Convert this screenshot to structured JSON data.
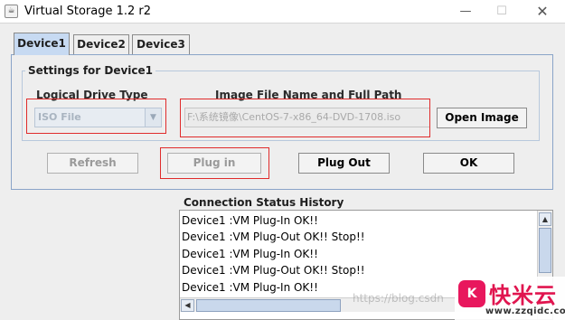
{
  "window": {
    "title": "Virtual Storage 1.2 r2",
    "app_icon": "☕",
    "minimize_glyph": "—",
    "maximize_glyph": "☐",
    "close_glyph": "✕"
  },
  "tabs": [
    {
      "label": "Device1",
      "selected": true
    },
    {
      "label": "Device2",
      "selected": false
    },
    {
      "label": "Device3",
      "selected": false
    }
  ],
  "settings": {
    "group_title": "Settings for Device1",
    "drive_type_label": "Logical Drive Type",
    "drive_type_value": "ISO File",
    "image_path_label": "Image File Name and Full Path",
    "image_path_value": "F:\\系统镜像\\CentOS-7-x86_64-DVD-1708.iso",
    "open_image_label": "Open Image"
  },
  "actions": {
    "refresh_label": "Refresh",
    "plug_in_label": "Plug in",
    "plug_out_label": "Plug Out",
    "ok_label": "OK"
  },
  "history": {
    "title": "Connection Status History",
    "entries": [
      "Device1 :VM Plug-In OK!!",
      "Device1 :VM Plug-Out OK!! Stop!!",
      "Device1 :VM Plug-In OK!!",
      "Device1 :VM Plug-Out OK!! Stop!!",
      "Device1 :VM Plug-In OK!!"
    ]
  },
  "overlay": {
    "watermark": "https://blog.csdn",
    "logo_text": "快米云",
    "logo_url": "www.zzqidc.com"
  },
  "colors": {
    "active_tab": "#c7daf2",
    "highlight_box": "#e02b2b",
    "logo": "#e0154f"
  }
}
